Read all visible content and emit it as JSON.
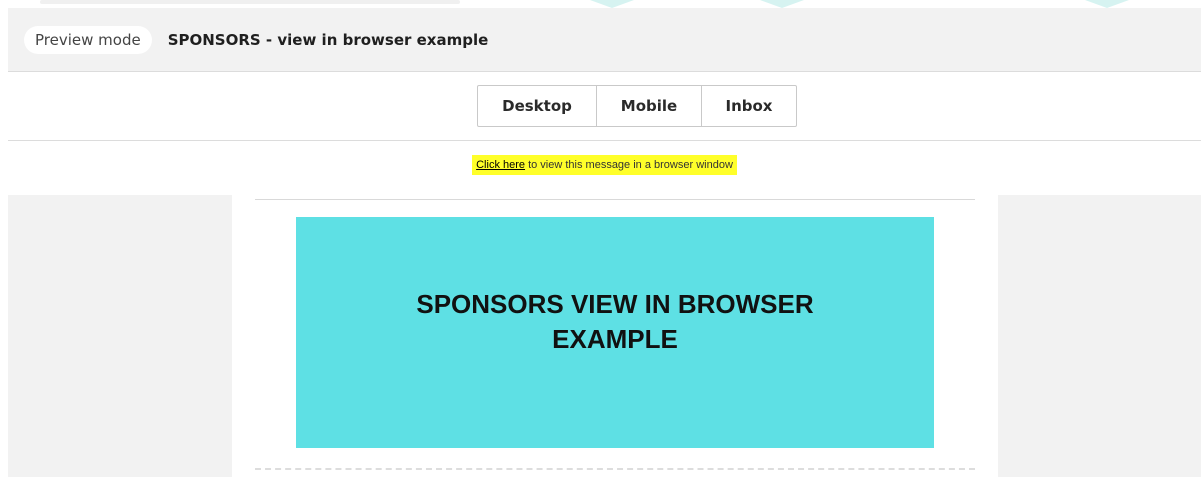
{
  "preview_bar": {
    "mode_label": "Preview mode",
    "title": "SPONSORS - view in browser example"
  },
  "view_tabs": [
    {
      "label": "Desktop"
    },
    {
      "label": "Mobile"
    },
    {
      "label": "Inbox"
    }
  ],
  "email": {
    "browser_link": {
      "link_text": "Click here",
      "rest_text": " to view this message in a browser window"
    },
    "banner": {
      "line1": "SPONSORS VIEW IN BROWSER",
      "line2": "EXAMPLE",
      "color": "#5ee0e4"
    }
  },
  "colors": {
    "highlight": "#ffff2a",
    "bar_bg": "#f2f2f2"
  }
}
